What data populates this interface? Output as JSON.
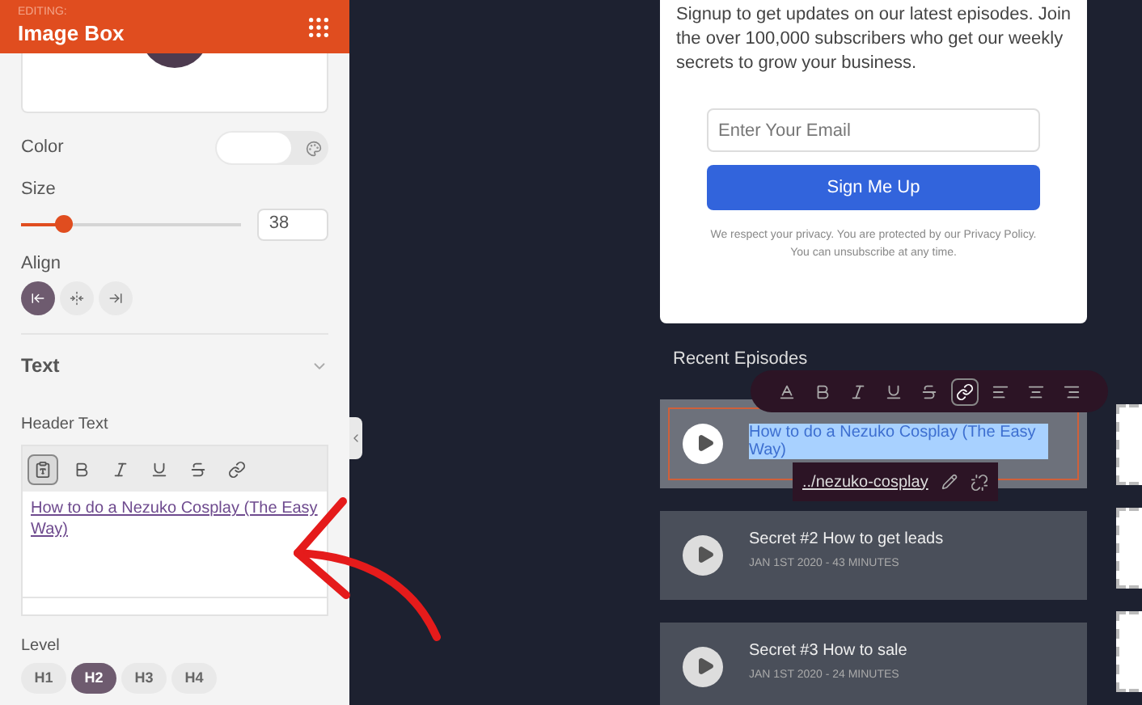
{
  "panel": {
    "editing_label": "EDITING:",
    "title": "Image Box",
    "color_label": "Color",
    "size": {
      "label": "Size",
      "level": 0.19,
      "value": "38"
    },
    "align": {
      "label": "Align",
      "options": [
        {
          "kind": "left",
          "selected": true
        },
        {
          "kind": "center",
          "selected": false
        },
        {
          "kind": "right",
          "selected": false
        }
      ]
    },
    "text_section": {
      "title": "Text",
      "expanded": true
    },
    "header_text": {
      "label": "Header Text",
      "tools": [
        {
          "kind": "paste",
          "selected": true
        },
        {
          "kind": "bold",
          "selected": false
        },
        {
          "kind": "italic",
          "selected": false
        },
        {
          "kind": "underline",
          "selected": false
        },
        {
          "kind": "strike",
          "selected": false
        },
        {
          "kind": "link",
          "selected": false
        }
      ],
      "value": "How to do a Nezuko Cosplay (The Easy Way)"
    },
    "level": {
      "label": "Level",
      "options": [
        {
          "label": "H1",
          "selected": false
        },
        {
          "label": "H2",
          "selected": true
        },
        {
          "label": "H3",
          "selected": false
        },
        {
          "label": "H4",
          "selected": false
        }
      ]
    }
  },
  "signup": {
    "text": "Signup to get updates on our latest episodes. Join the over 100,000 subscribers who get our weekly secrets to grow your business.",
    "email_placeholder": "Enter Your Email",
    "button": "Sign Me Up",
    "privacy": "We respect your privacy. You are protected by our Privacy Policy. You can unsubscribe at any time."
  },
  "episodes_title": "Recent Episodes",
  "episodes": [
    {
      "title": "How to do a Nezuko Cosplay (The Easy Way)",
      "selected": true
    },
    {
      "title": "Secret #2 How to get leads",
      "meta": "JAN 1ST 2020 - 43 MINUTES",
      "selected": false
    },
    {
      "title": "Secret #3 How to sale",
      "meta": "JAN 1ST 2020 - 24  MINUTES",
      "selected": false
    }
  ],
  "text_toolbar": {
    "tools": [
      {
        "kind": "color",
        "selected": false
      },
      {
        "kind": "bold",
        "selected": false
      },
      {
        "kind": "italic",
        "selected": false
      },
      {
        "kind": "underline",
        "selected": false
      },
      {
        "kind": "strike",
        "selected": false
      },
      {
        "kind": "link",
        "selected": true
      },
      {
        "kind": "align-left",
        "selected": false
      },
      {
        "kind": "align-center",
        "selected": false
      },
      {
        "kind": "align-right",
        "selected": false
      }
    ]
  },
  "link_popover": {
    "url": "../nezuko-cosplay"
  }
}
